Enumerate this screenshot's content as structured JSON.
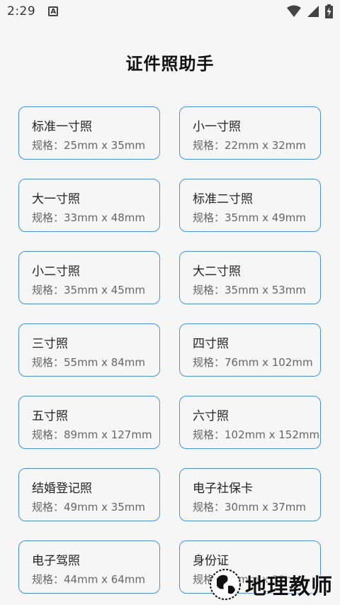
{
  "status_bar": {
    "time": "2:29",
    "notification_icon": "A"
  },
  "title": "证件照助手",
  "cards": [
    {
      "name": "标准一寸照",
      "spec": "规格：25mm x 35mm"
    },
    {
      "name": "小一寸照",
      "spec": "规格：22mm x 32mm"
    },
    {
      "name": "大一寸照",
      "spec": "规格：33mm x 48mm"
    },
    {
      "name": "标准二寸照",
      "spec": "规格：35mm x 49mm"
    },
    {
      "name": "小二寸照",
      "spec": "规格：35mm x 45mm"
    },
    {
      "name": "大二寸照",
      "spec": "规格：35mm x 53mm"
    },
    {
      "name": "三寸照",
      "spec": "规格：55mm x 84mm"
    },
    {
      "name": "四寸照",
      "spec": "规格：76mm x 102mm"
    },
    {
      "name": "五寸照",
      "spec": "规格：89mm x 127mm"
    },
    {
      "name": "六寸照",
      "spec": "规格：102mm x 152mm"
    },
    {
      "name": "结婚登记照",
      "spec": "规格：49mm x 35mm"
    },
    {
      "name": "电子社保卡",
      "spec": "规格：30mm x 37mm"
    },
    {
      "name": "电子驾照",
      "spec": "规格：44mm x 64mm"
    },
    {
      "name": "身份证",
      "spec": "规格：26mm x 32mm"
    }
  ],
  "watermark": "地理教师",
  "colors": {
    "card_border": "#4a90d9",
    "background": "#f6f6f6"
  }
}
